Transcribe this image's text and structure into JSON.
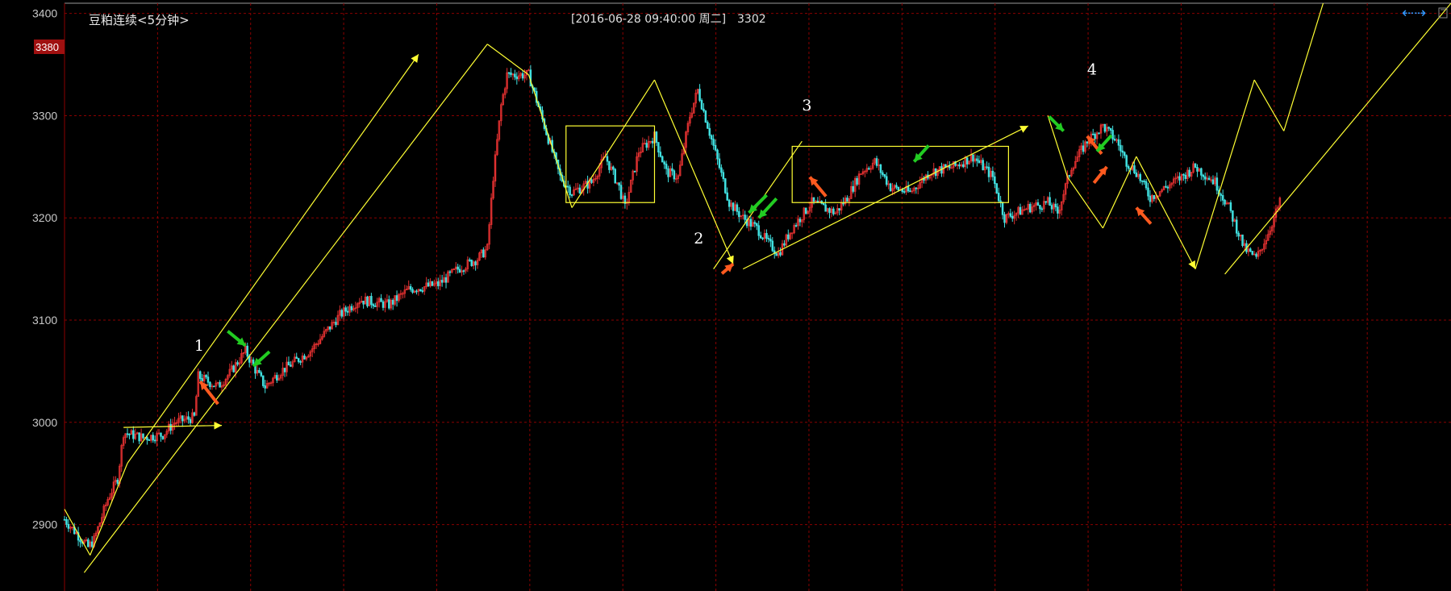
{
  "chart": {
    "title": "豆粕连续<5分钟>",
    "cursor_info": {
      "datetime": "[2016-06-28  09:40:00 周二]",
      "price": "3302"
    },
    "current_price_badge": "3380",
    "nav_icon": "double-arrow-icon",
    "colors": {
      "background": "#000000",
      "grid": "#8b0000",
      "up_candle": "#e03030",
      "down_candle": "#40e0e0",
      "trendline": "#ffff33",
      "badge": "#a01010",
      "arrow_red": "#ff5a1f",
      "arrow_green": "#22cc22",
      "nav_icon": "#3399ff"
    }
  },
  "chart_data": {
    "type": "candlestick",
    "title": "豆粕连续<5分钟>",
    "ylim": [
      2835,
      3410
    ],
    "yticks": [
      2900,
      3000,
      3100,
      3200,
      3300,
      3400
    ],
    "grid": true,
    "vertical_gridlines": 14,
    "annotations": [
      {
        "label": "1",
        "bar": 66,
        "price": 3070
      },
      {
        "label": "2",
        "bar": 320,
        "price": 3175
      },
      {
        "label": "3",
        "bar": 375,
        "price": 3305
      },
      {
        "label": "4",
        "bar": 520,
        "price": 3340
      }
    ],
    "trendlines": [
      {
        "from": [
          0,
          2915
        ],
        "to": [
          13,
          2870
        ],
        "arrow": false
      },
      {
        "from": [
          13,
          2870
        ],
        "to": [
          32,
          2960
        ],
        "arrow": false
      },
      {
        "from": [
          32,
          2960
        ],
        "to": [
          180,
          3360
        ],
        "arrow": true
      },
      {
        "from": [
          10,
          2853
        ],
        "to": [
          215,
          3370
        ],
        "arrow": false
      },
      {
        "from": [
          215,
          3370
        ],
        "to": [
          236,
          3340
        ],
        "arrow": false
      },
      {
        "from": [
          236,
          3340
        ],
        "to": [
          258,
          3210
        ],
        "arrow": false
      },
      {
        "from": [
          258,
          3210
        ],
        "to": [
          300,
          3335
        ],
        "arrow": false
      },
      {
        "from": [
          300,
          3335
        ],
        "to": [
          340,
          3155
        ],
        "arrow": true
      },
      {
        "from": [
          330,
          3150
        ],
        "to": [
          375,
          3275
        ],
        "arrow": false
      },
      {
        "from": [
          345,
          3150
        ],
        "to": [
          490,
          3290
        ],
        "arrow": true
      },
      {
        "from": [
          30,
          2995
        ],
        "to": [
          80,
          2997
        ],
        "arrow": true
      },
      {
        "from": [
          500,
          3300
        ],
        "to": [
          510,
          3240
        ],
        "arrow": false
      },
      {
        "from": [
          510,
          3240
        ],
        "to": [
          528,
          3190
        ],
        "arrow": false
      },
      {
        "from": [
          528,
          3190
        ],
        "to": [
          545,
          3260
        ],
        "arrow": false
      },
      {
        "from": [
          545,
          3260
        ],
        "to": [
          575,
          3150
        ],
        "arrow": true
      },
      {
        "from": [
          575,
          3150
        ],
        "to": [
          605,
          3335
        ],
        "arrow": false
      },
      {
        "from": [
          605,
          3335
        ],
        "to": [
          620,
          3285
        ],
        "arrow": false
      },
      {
        "from": [
          620,
          3285
        ],
        "to": [
          640,
          3410
        ],
        "arrow": false
      },
      {
        "from": [
          590,
          3145
        ],
        "to": [
          705,
          3410
        ],
        "arrow": false
      }
    ],
    "boxes": [
      {
        "from": [
          255,
          3215
        ],
        "to": [
          300,
          3290
        ]
      },
      {
        "from": [
          370,
          3215
        ],
        "to": [
          480,
          3270
        ]
      }
    ]
  }
}
